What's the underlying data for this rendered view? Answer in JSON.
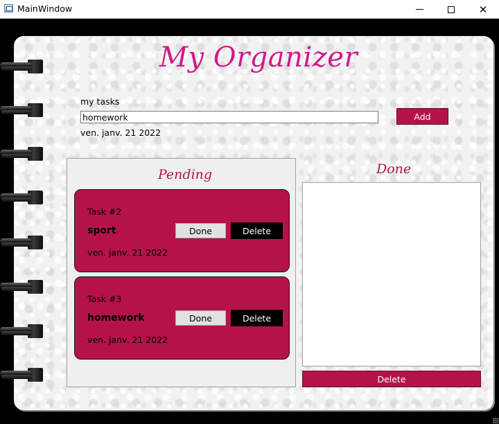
{
  "window": {
    "title": "MainWindow",
    "minimize_glyph": "",
    "maximize_glyph": "",
    "close_glyph": "✕"
  },
  "app": {
    "heading": "My Organizer"
  },
  "form": {
    "tasks_label": "my tasks",
    "task_input_value": "homework",
    "add_label": "Add",
    "date": "ven. janv. 21 2022"
  },
  "pending": {
    "title": "Pending",
    "tasks": [
      {
        "number": "Task #2",
        "name": "sport",
        "date": "ven. janv. 21 2022",
        "done_label": "Done",
        "delete_label": "Delete"
      },
      {
        "number": "Task #3",
        "name": "homework",
        "date": "ven. janv. 21 2022",
        "done_label": "Done",
        "delete_label": "Delete"
      }
    ]
  },
  "done": {
    "title": "Done",
    "items": [],
    "delete_label": "Delete"
  },
  "colors": {
    "accent": "#b5124a",
    "heading": "#d01a88",
    "page": "#f2f2f2"
  },
  "icons": {
    "app": "window-app-icon",
    "minimize": "minimize-icon",
    "maximize": "maximize-icon",
    "close": "close-icon",
    "spiral": "spiral-ring-icon"
  }
}
